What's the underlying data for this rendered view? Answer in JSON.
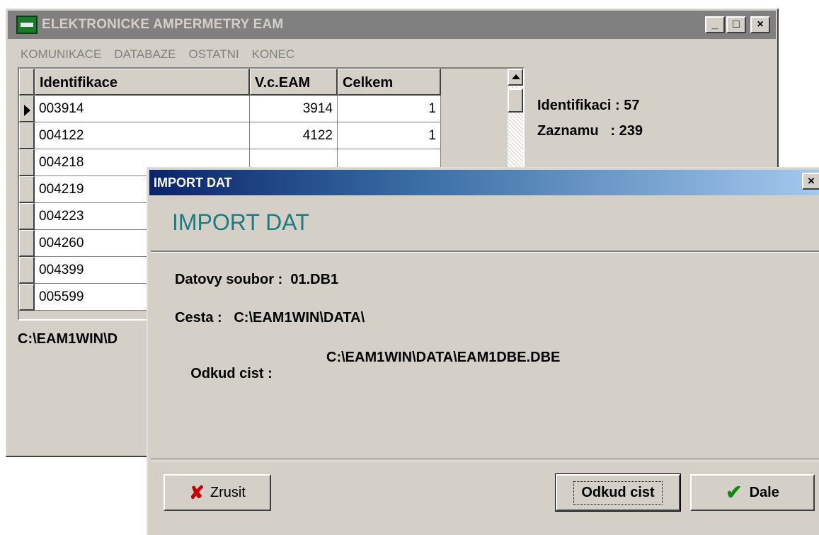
{
  "main_window": {
    "title": "ELEKTRONICKE AMPERMETRY EAM",
    "caption_buttons": [
      "_",
      "□",
      "×"
    ],
    "menu": [
      "KOMUNIKACE",
      "DATABAZE",
      "OSTATNI",
      "KONEC"
    ]
  },
  "grid": {
    "columns": [
      "Identifikace",
      "V.c.EAM",
      "Celkem"
    ],
    "rows": [
      {
        "id": "003914",
        "vc": "3914",
        "celkem": "1"
      },
      {
        "id": "004122",
        "vc": "4122",
        "celkem": "1"
      },
      {
        "id": "004218",
        "vc": "",
        "celkem": ""
      },
      {
        "id": "004219",
        "vc": "",
        "celkem": ""
      },
      {
        "id": "004223",
        "vc": "",
        "celkem": ""
      },
      {
        "id": "004260",
        "vc": "",
        "celkem": ""
      },
      {
        "id": "004399",
        "vc": "",
        "celkem": ""
      },
      {
        "id": "005599",
        "vc": "",
        "celkem": ""
      }
    ]
  },
  "stats": {
    "identifikaci": "Identifikaci : 57",
    "zaznamu": "Zaznamu   : 239"
  },
  "path_line": "C:\\EAM1WIN\\D",
  "dialog": {
    "title": "IMPORT DAT",
    "close_label": "×",
    "heading": "IMPORT DAT",
    "datovy_soubor": "Datovy soubor :  01.DB1",
    "cesta": "Cesta :   C:\\EAM1WIN\\DATA\\",
    "odkud_label": "Odkud cist :",
    "odkud_value": "C:\\EAM1WIN\\DATA\\EAM1DBE.DBE",
    "buttons": {
      "zrusit": "Zrusit",
      "odkud": "Odkud cist",
      "dale": "Dale"
    }
  },
  "icons": {
    "cancel": "cross-icon",
    "ok": "check-icon"
  }
}
